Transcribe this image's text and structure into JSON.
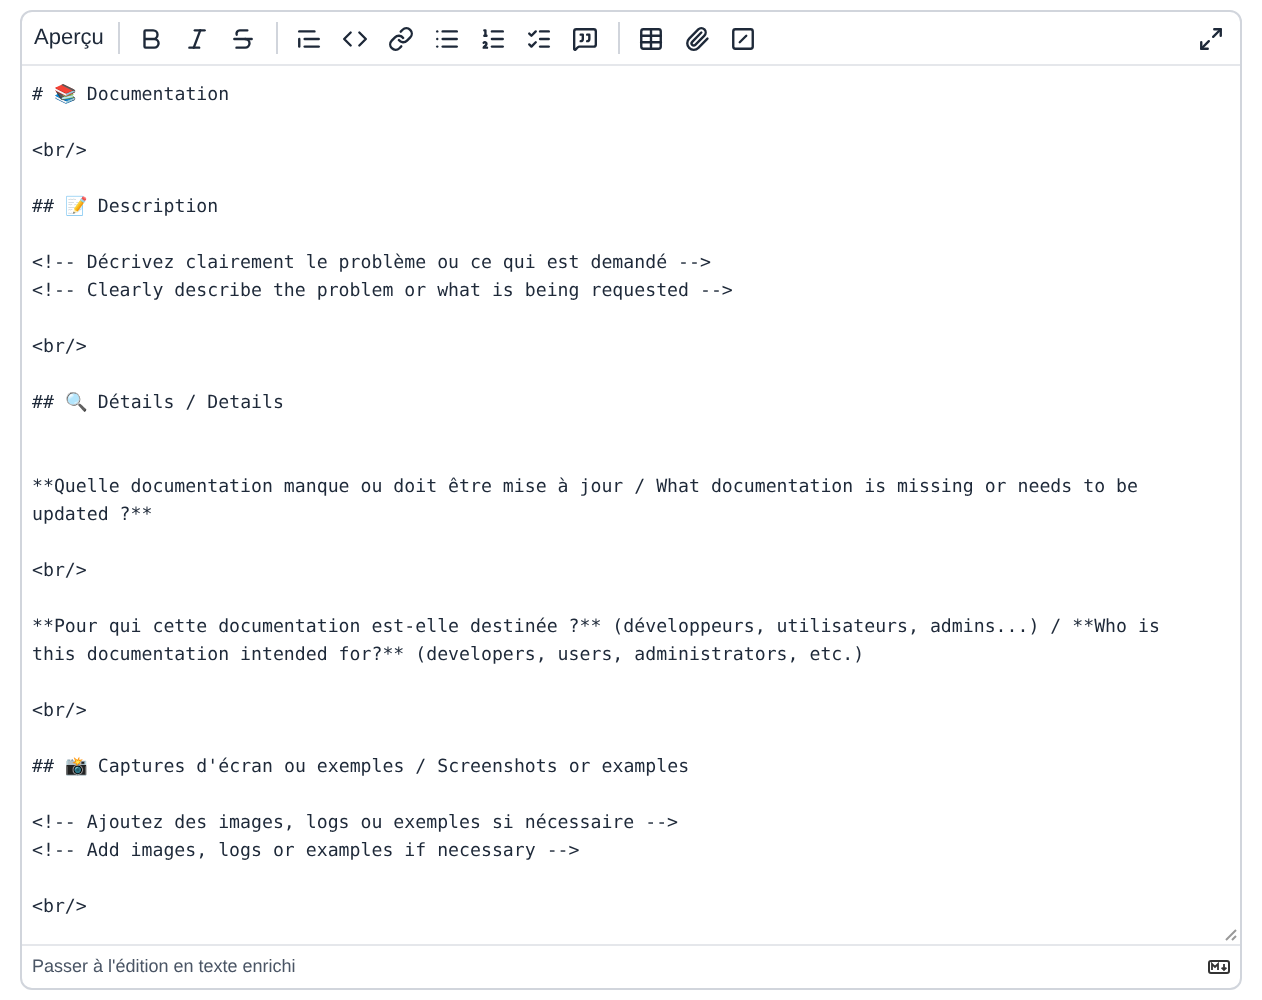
{
  "toolbar": {
    "preview_button": "Aperçu"
  },
  "editor": {
    "blocks": [
      {
        "kind": "first",
        "lines": [
          "# 📚 Documentation"
        ]
      },
      {
        "kind": "after-gap",
        "lines": [
          "<br/>"
        ]
      },
      {
        "kind": "after-gap",
        "lines": [
          "## 📝 Description"
        ]
      },
      {
        "kind": "after-gap",
        "lines": [
          "<!-- Décrivez clairement le problème ou ce qui est demandé -->",
          "<!-- Clearly describe the problem or what is being requested -->"
        ]
      },
      {
        "kind": "after-gap",
        "lines": [
          "<br/>"
        ]
      },
      {
        "kind": "after-gap",
        "lines": [
          "## 🔍 Détails / Details"
        ]
      },
      {
        "kind": "after-double-gap",
        "lines": [
          "**Quelle documentation manque ou doit être mise à jour / What documentation is missing or needs to be",
          "updated ?**"
        ]
      },
      {
        "kind": "after-gap",
        "lines": [
          "<br/>"
        ]
      },
      {
        "kind": "after-gap",
        "lines": [
          "**Pour qui cette documentation est-elle destinée ?** (développeurs, utilisateurs, admins...) / **Who is",
          "this documentation intended for?** (developers, users, administrators, etc.)"
        ]
      },
      {
        "kind": "after-gap",
        "lines": [
          "<br/>"
        ]
      },
      {
        "kind": "after-gap",
        "lines": [
          "## 📸 Captures d'écran ou exemples / Screenshots or examples"
        ]
      },
      {
        "kind": "after-gap",
        "lines": [
          "<!-- Ajoutez des images, logs ou exemples si nécessaire -->",
          "<!-- Add images, logs or examples if necessary -->"
        ]
      },
      {
        "kind": "after-gap",
        "lines": [
          "<br/>"
        ]
      }
    ]
  },
  "footer": {
    "rich_text_link": "Passer à l'édition en texte enrichi"
  }
}
